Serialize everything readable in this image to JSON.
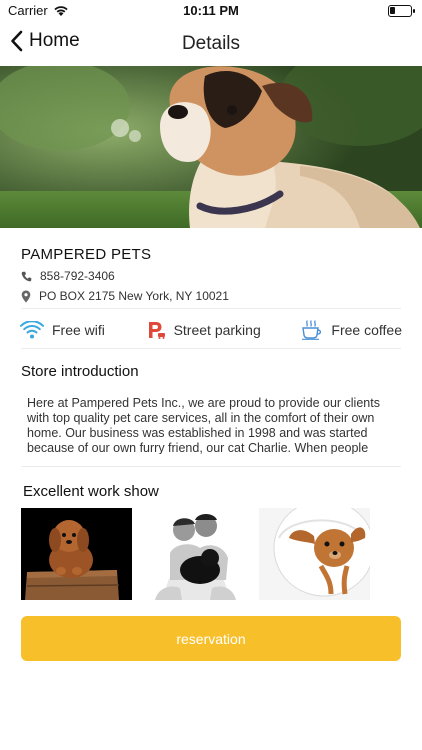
{
  "status_bar": {
    "carrier": "Carrier",
    "time": "10:11 PM",
    "battery_level": 0.25
  },
  "nav": {
    "back_label": "Home",
    "title": "Details"
  },
  "store": {
    "name": "PAMPERED PETS",
    "phone": "858-792-3406",
    "address": "PO BOX 2175 New York, NY 10021"
  },
  "amenities": [
    {
      "label": "Free wifi",
      "icon": "wifi-icon",
      "color": "#3aa7e0"
    },
    {
      "label": "Street parking",
      "icon": "parking-icon",
      "color": "#e0483a"
    },
    {
      "label": "Free coffee",
      "icon": "coffee-icon",
      "color": "#4a8fd6"
    }
  ],
  "intro": {
    "title": "Store introduction",
    "text": "Here at Pampered Pets Inc., we are proud to provide our clients with top quality pet care services, all in the comfort of their own home. Our business was established in 1998 and was started because of our own furry friend, our cat Charlie. When people"
  },
  "gallery": {
    "title": "Excellent work show"
  },
  "reservation": {
    "label": "reservation",
    "color": "#f7c02b"
  }
}
